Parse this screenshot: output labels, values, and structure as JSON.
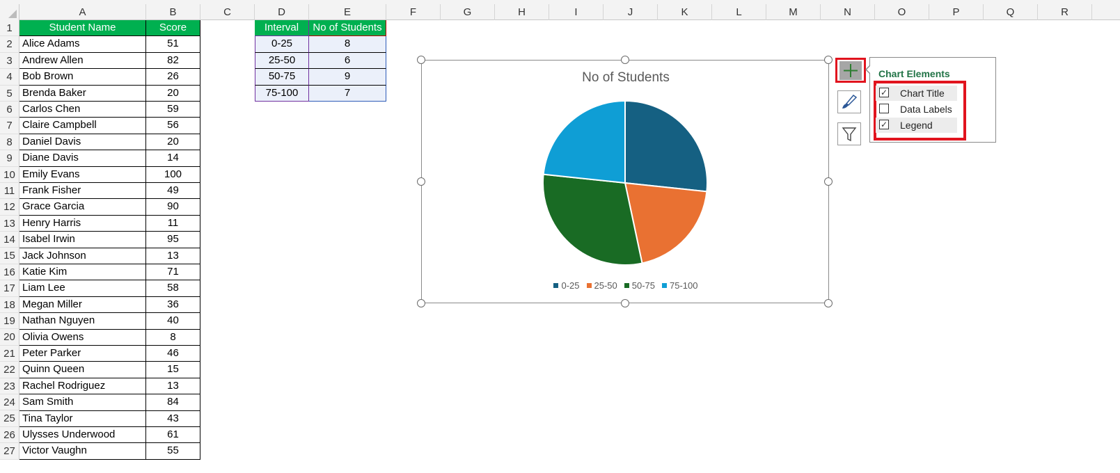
{
  "columns": [
    "A",
    "B",
    "C",
    "D",
    "E",
    "F",
    "G",
    "H",
    "I",
    "J",
    "K",
    "L",
    "M",
    "N",
    "O",
    "P",
    "Q",
    "R"
  ],
  "rows": [
    "1",
    "2",
    "3",
    "4",
    "5",
    "6",
    "7",
    "8",
    "9",
    "10",
    "11",
    "12",
    "13",
    "14",
    "15",
    "16",
    "17",
    "18",
    "19",
    "20",
    "21",
    "22",
    "23",
    "24",
    "25",
    "26",
    "27"
  ],
  "students": {
    "header": {
      "name": "Student Name",
      "score": "Score"
    },
    "items": [
      {
        "name": "Alice Adams",
        "score": "51"
      },
      {
        "name": "Andrew Allen",
        "score": "82"
      },
      {
        "name": "Bob Brown",
        "score": "26"
      },
      {
        "name": "Brenda Baker",
        "score": "20"
      },
      {
        "name": "Carlos Chen",
        "score": "59"
      },
      {
        "name": "Claire Campbell",
        "score": "56"
      },
      {
        "name": "Daniel Davis",
        "score": "20"
      },
      {
        "name": "Diane Davis",
        "score": "14"
      },
      {
        "name": "Emily Evans",
        "score": "100"
      },
      {
        "name": "Frank Fisher",
        "score": "49"
      },
      {
        "name": "Grace Garcia",
        "score": "90"
      },
      {
        "name": "Henry Harris",
        "score": "11"
      },
      {
        "name": "Isabel Irwin",
        "score": "95"
      },
      {
        "name": "Jack Johnson",
        "score": "13"
      },
      {
        "name": "Katie Kim",
        "score": "71"
      },
      {
        "name": "Liam Lee",
        "score": "58"
      },
      {
        "name": "Megan Miller",
        "score": "36"
      },
      {
        "name": "Nathan Nguyen",
        "score": "40"
      },
      {
        "name": "Olivia Owens",
        "score": "8"
      },
      {
        "name": "Peter Parker",
        "score": "46"
      },
      {
        "name": "Quinn Queen",
        "score": "15"
      },
      {
        "name": "Rachel Rodriguez",
        "score": "13"
      },
      {
        "name": "Sam Smith",
        "score": "84"
      },
      {
        "name": "Tina Taylor",
        "score": "43"
      },
      {
        "name": "Ulysses Underwood",
        "score": "61"
      },
      {
        "name": "Victor Vaughn",
        "score": "55"
      }
    ]
  },
  "intervals": {
    "header": {
      "interval": "Interval",
      "count": "No of Students"
    },
    "items": [
      {
        "interval": "0-25",
        "count": "8"
      },
      {
        "interval": "25-50",
        "count": "6"
      },
      {
        "interval": "50-75",
        "count": "9"
      },
      {
        "interval": "75-100",
        "count": "7"
      }
    ]
  },
  "chart_data": {
    "type": "pie",
    "title": "No of Students",
    "categories": [
      "0-25",
      "25-50",
      "50-75",
      "75-100"
    ],
    "values": [
      8,
      6,
      9,
      7
    ],
    "colors": [
      "#156082",
      "#e97132",
      "#196b24",
      "#0f9ed5"
    ],
    "legend": "bottom"
  },
  "chart_elements": {
    "title": "Chart Elements",
    "options": [
      {
        "label": "Chart Title",
        "checked": true
      },
      {
        "label": "Data Labels",
        "checked": false
      },
      {
        "label": "Legend",
        "checked": true
      }
    ]
  },
  "icons": {
    "add": "plus-icon",
    "styles": "brush-icon",
    "filters": "funnel-icon"
  }
}
